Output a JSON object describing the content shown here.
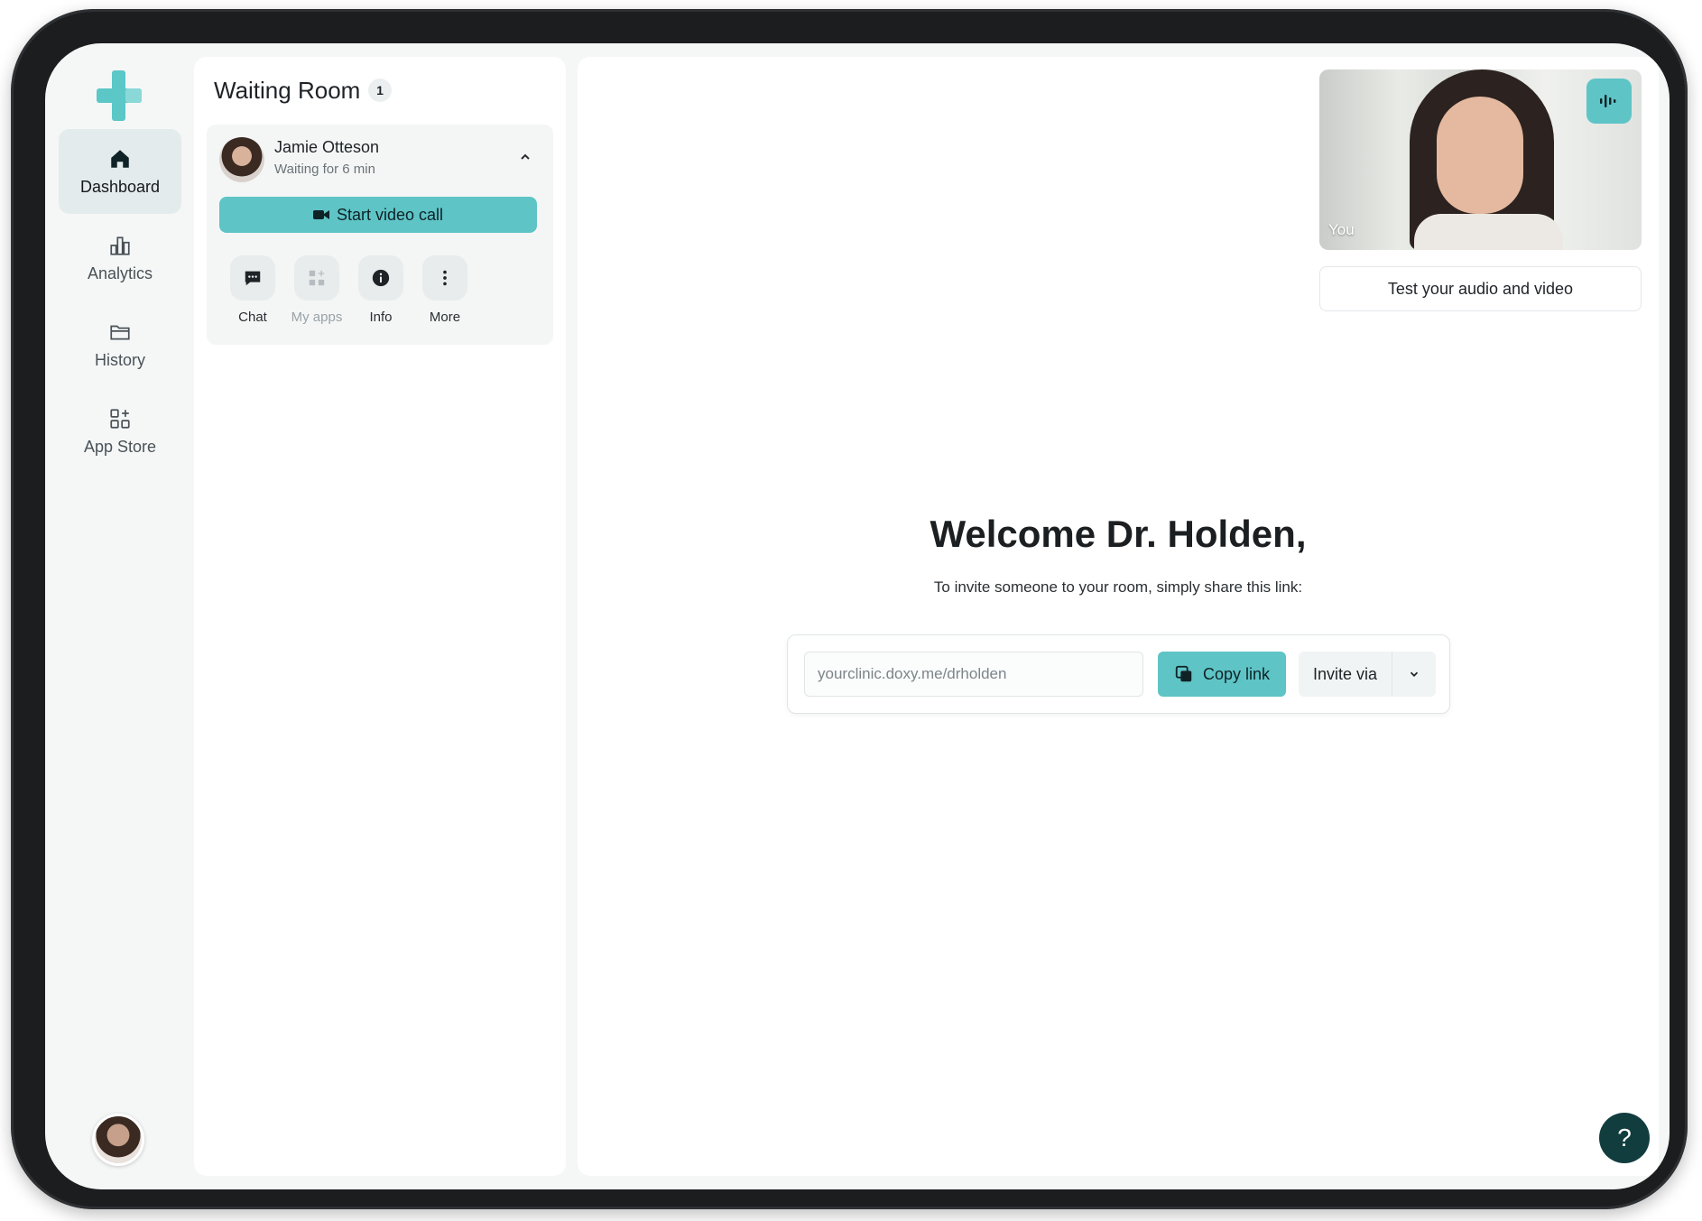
{
  "nav": {
    "items": [
      {
        "label": "Dashboard",
        "icon": "home-icon",
        "active": true
      },
      {
        "label": "Analytics",
        "icon": "bar-chart-icon",
        "active": false
      },
      {
        "label": "History",
        "icon": "folder-icon",
        "active": false
      },
      {
        "label": "App Store",
        "icon": "apps-add-icon",
        "active": false
      }
    ]
  },
  "waiting_room": {
    "title": "Waiting Room",
    "count": "1",
    "patient": {
      "name": "Jamie Otteson",
      "status": "Waiting for 6 min"
    },
    "start_call_label": "Start video call",
    "actions": [
      {
        "label": "Chat",
        "icon": "chat-icon",
        "disabled": false
      },
      {
        "label": "My apps",
        "icon": "apps-icon",
        "disabled": true
      },
      {
        "label": "Info",
        "icon": "info-icon",
        "disabled": false
      },
      {
        "label": "More",
        "icon": "more-vertical-icon",
        "disabled": false
      }
    ]
  },
  "self_view": {
    "label": "You",
    "test_label": "Test your audio and video"
  },
  "main": {
    "welcome": "Welcome Dr. Holden,",
    "invite_text": "To invite someone to your room, simply share this link:",
    "link_placeholder": "yourclinic.doxy.me/drholden",
    "copy_label": "Copy link",
    "invite_label": "Invite via"
  },
  "help_label": "?",
  "colors": {
    "accent": "#5ec4c6",
    "help_bg": "#123d3f",
    "frame": "#1b1d1f"
  }
}
